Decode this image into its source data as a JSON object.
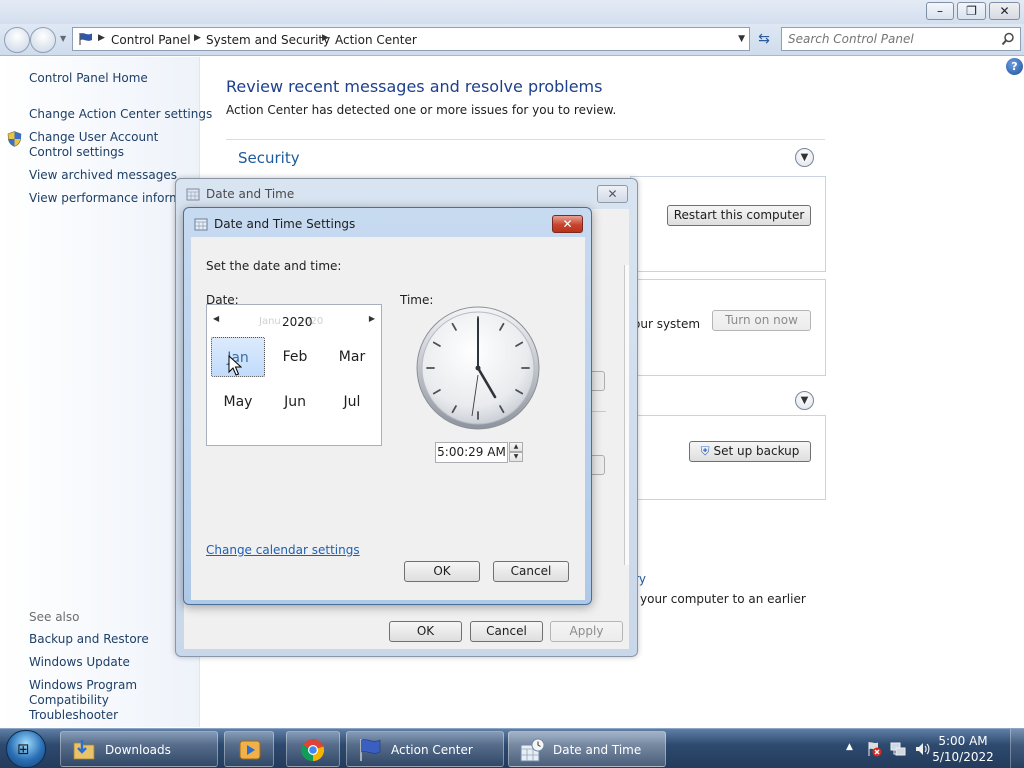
{
  "window": {
    "minimize": "–",
    "maximize": "❐",
    "close": "✕"
  },
  "address": {
    "breadcrumb": [
      "Control Panel",
      "System and Security",
      "Action Center"
    ],
    "search_placeholder": "Search Control Panel"
  },
  "nav": {
    "home": "Control Panel Home",
    "items": [
      "Change Action Center settings",
      "Change User Account Control settings",
      "View archived messages",
      "View performance informat"
    ],
    "see_also_label": "See also",
    "see_also": [
      "Backup and Restore",
      "Windows Update",
      "Windows Program Compatibility Troubleshooter"
    ]
  },
  "main": {
    "heading": "Review recent messages and resolve problems",
    "subheading": "Action Center has detected one or more issues for you to review.",
    "security_heading": "Security",
    "restart_button": "Restart this computer",
    "system_text_fragment": "our system",
    "turn_on_button": "Turn on now",
    "backup_button": "Set up backup",
    "fragment_ne": "ne",
    "fragment_ry": "ry",
    "restore_text_fragment": "your computer to an earlier"
  },
  "date_time_dialog": {
    "title": "Date and Time",
    "close": "✕",
    "ok": "OK",
    "cancel": "Cancel",
    "apply": "Apply"
  },
  "settings_dialog": {
    "title": "Date and Time Settings",
    "close": "✕",
    "prompt": "Set the date and time:",
    "date_label": "Date:",
    "time_label": "Time:",
    "calendar": {
      "prev": "◀",
      "next": "▶",
      "ghost": "Janu",
      "ghost2": "2020",
      "year": "2020",
      "months": [
        "Jan",
        "Feb",
        "Mar",
        "May",
        "Jun",
        "Jul"
      ],
      "selected_month": "Jan"
    },
    "time_value": "5:00:29 AM",
    "change_calendar_link": "Change calendar settings",
    "ok": "OK",
    "cancel": "Cancel"
  },
  "taskbar": {
    "buttons": [
      "Downloads",
      "Action Center",
      "Date and Time"
    ],
    "active_button": "Date and Time",
    "clock_time": "5:00 AM",
    "clock_date": "5/10/2022"
  },
  "colors": {
    "link_blue": "#1e3f66",
    "heading_blue": "#1e3f8c",
    "close_red": "#c8442d"
  }
}
